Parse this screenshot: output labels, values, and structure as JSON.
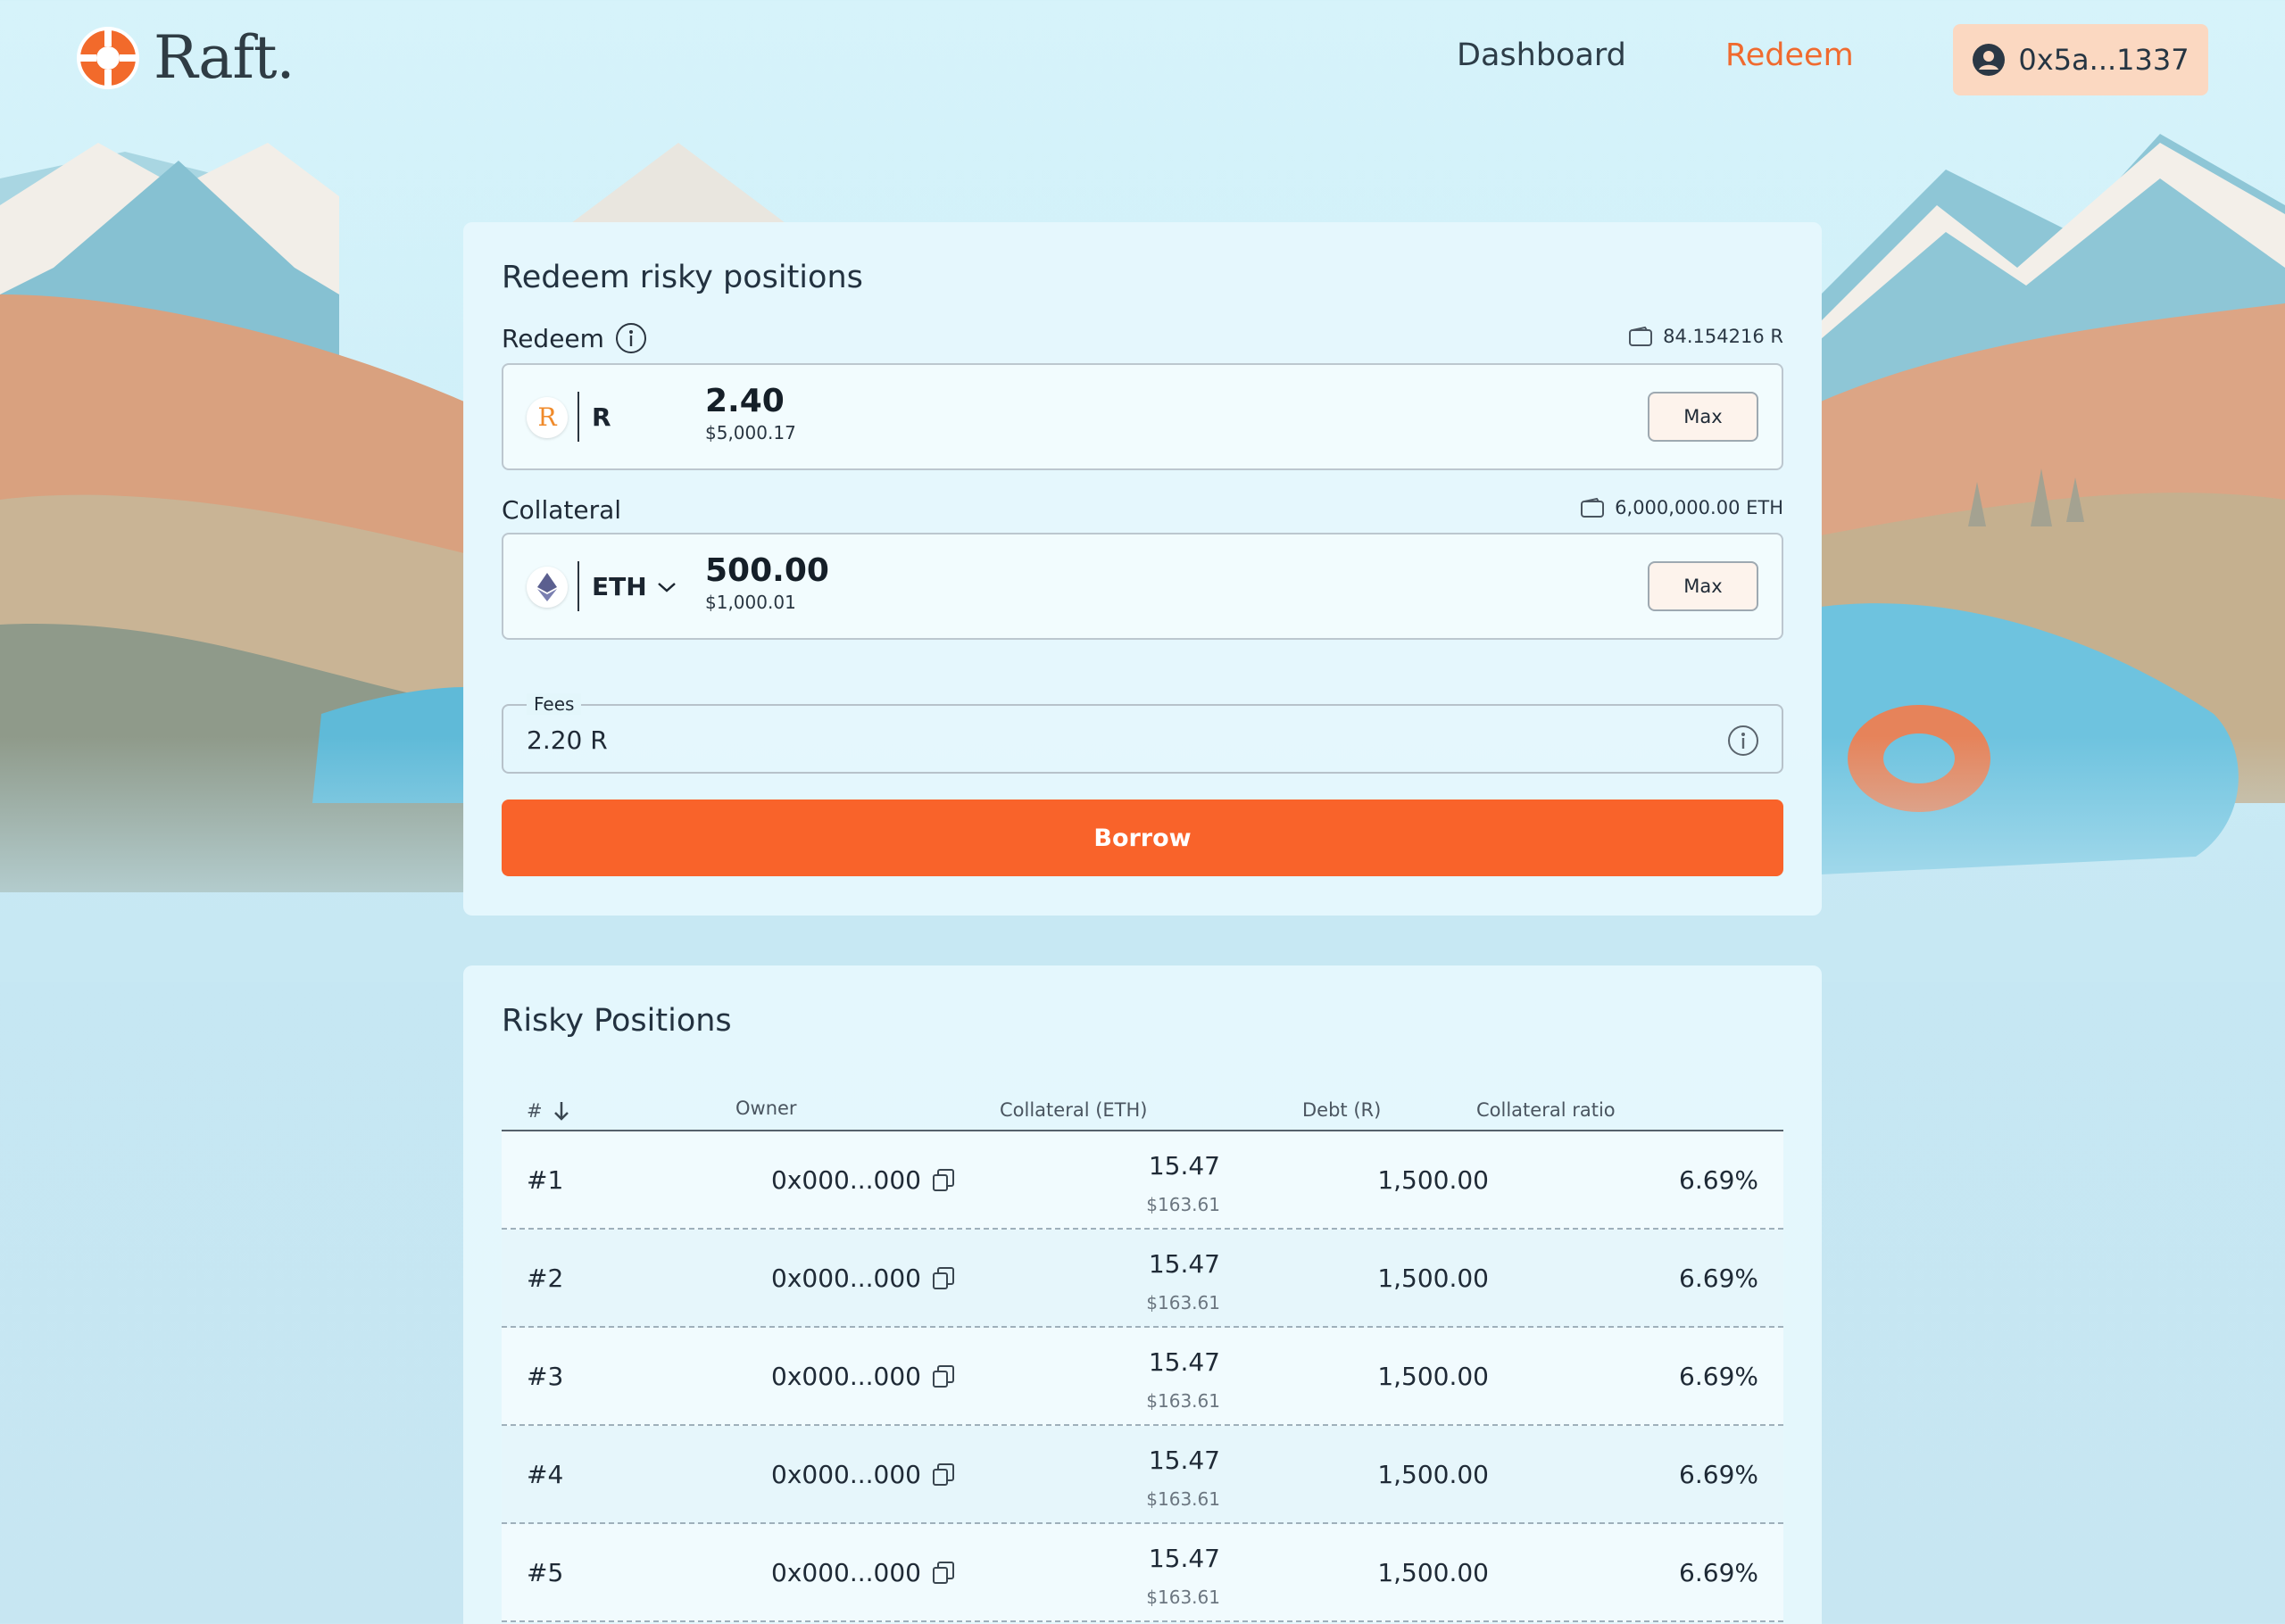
{
  "brand": {
    "name": "Raft.",
    "accent": "#f9632a"
  },
  "nav": {
    "dashboard_label": "Dashboard",
    "redeem_label": "Redeem",
    "wallet_label": "0x5a...1337",
    "active": "Redeem"
  },
  "redeem_card": {
    "title": "Redeem risky positions",
    "redeem": {
      "label": "Redeem",
      "balance": "84.154216 R",
      "token": "R",
      "amount": "2.40",
      "amount_usd": "$5,000.17",
      "max_label": "Max"
    },
    "collateral": {
      "label": "Collateral",
      "balance": "6,000,000.00 ETH",
      "token": "ETH",
      "amount": "500.00",
      "amount_usd": "$1,000.01",
      "max_label": "Max"
    },
    "fees": {
      "legend": "Fees",
      "value": "2.20 R"
    },
    "submit_label": "Borrow"
  },
  "risky_positions": {
    "title": "Risky Positions",
    "columns": {
      "index": "#",
      "owner": "Owner",
      "collateral": "Collateral (ETH)",
      "debt": "Debt (R)",
      "ratio": "Collateral ratio"
    },
    "rows": [
      {
        "index": "#1",
        "owner": "0x000...000",
        "collateral": "15.47",
        "collateral_usd": "$163.61",
        "debt": "1,500.00",
        "ratio": "6.69%"
      },
      {
        "index": "#2",
        "owner": "0x000...000",
        "collateral": "15.47",
        "collateral_usd": "$163.61",
        "debt": "1,500.00",
        "ratio": "6.69%"
      },
      {
        "index": "#3",
        "owner": "0x000...000",
        "collateral": "15.47",
        "collateral_usd": "$163.61",
        "debt": "1,500.00",
        "ratio": "6.69%"
      },
      {
        "index": "#4",
        "owner": "0x000...000",
        "collateral": "15.47",
        "collateral_usd": "$163.61",
        "debt": "1,500.00",
        "ratio": "6.69%"
      },
      {
        "index": "#5",
        "owner": "0x000...000",
        "collateral": "15.47",
        "collateral_usd": "$163.61",
        "debt": "1,500.00",
        "ratio": "6.69%"
      }
    ]
  }
}
